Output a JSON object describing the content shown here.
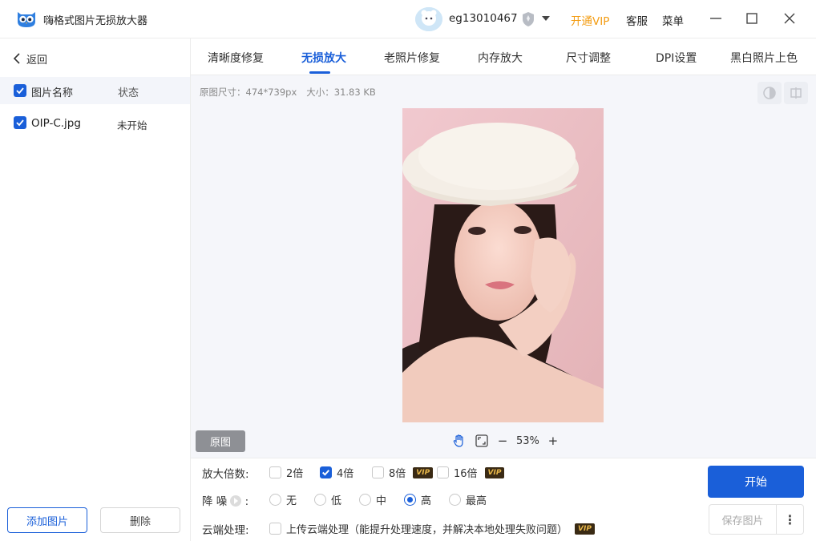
{
  "app": {
    "title": "嗨格式图片无损放大器",
    "username": "eg13010467",
    "vip_link": "开通VIP",
    "service": "客服",
    "menu": "菜单",
    "colors": {
      "accent": "#1a5fd9",
      "vip": "#f39c12"
    }
  },
  "sidebar": {
    "back_label": "返回",
    "header_name": "图片名称",
    "header_status": "状态",
    "files": [
      {
        "name": "OIP-C.jpg",
        "status": "未开始",
        "checked": true
      }
    ],
    "add_label": "添加图片",
    "delete_label": "删除"
  },
  "tabs": [
    {
      "label": "清晰度修复",
      "active": false
    },
    {
      "label": "无损放大",
      "active": true
    },
    {
      "label": "老照片修复",
      "active": false
    },
    {
      "label": "内存放大",
      "active": false
    },
    {
      "label": "尺寸调整",
      "active": false
    },
    {
      "label": "DPI设置",
      "active": false
    },
    {
      "label": "黑白照片上色",
      "active": false
    }
  ],
  "preview": {
    "size_info": "原图尺寸：474*739px",
    "file_size": "大小：31.83 KB",
    "original_label": "原图",
    "zoom_level": "53%",
    "zoom_out": "−",
    "zoom_in": "+"
  },
  "settings": {
    "scale_label": "放大倍数:",
    "scale_options": [
      {
        "label": "2倍",
        "checked": false,
        "vip": false
      },
      {
        "label": "4倍",
        "checked": true,
        "vip": false
      },
      {
        "label": "8倍",
        "checked": false,
        "vip": true
      },
      {
        "label": "16倍",
        "checked": false,
        "vip": true
      }
    ],
    "denoise_label": "降 噪",
    "denoise_colon": ":",
    "denoise_options": [
      {
        "label": "无",
        "selected": false
      },
      {
        "label": "低",
        "selected": false
      },
      {
        "label": "中",
        "selected": false
      },
      {
        "label": "高",
        "selected": true
      },
      {
        "label": "最高",
        "selected": false
      }
    ],
    "cloud_label": "云端处理:",
    "cloud_option": "上传云端处理（能提升处理速度，并解决本地处理失败问题）",
    "vip_badge": "VIP",
    "start_label": "开始",
    "save_label": "保存图片",
    "more_label": "⋮"
  }
}
